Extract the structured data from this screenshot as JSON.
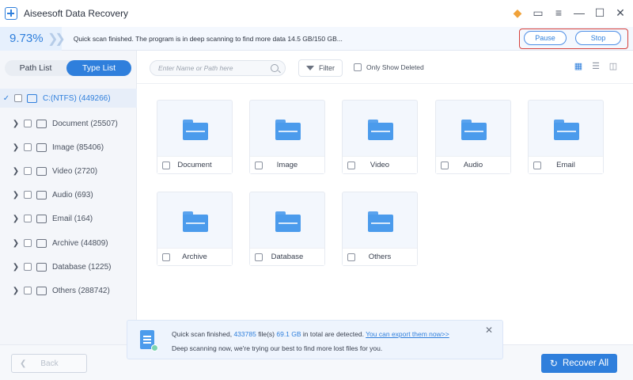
{
  "app": {
    "title": "Aiseesoft Data Recovery"
  },
  "titlebar_icons": [
    "diamond-icon",
    "feedback-icon",
    "menu-icon",
    "minimize-icon",
    "maximize-icon",
    "close-icon"
  ],
  "scan": {
    "percent": "9.73%",
    "progress_fraction": 0.0973,
    "message": "Quick scan finished. The program is in deep scanning to find more data 14.5 GB/150 GB...",
    "pause_label": "Pause",
    "stop_label": "Stop"
  },
  "sidebar": {
    "path_list_label": "Path List",
    "type_list_label": "Type List",
    "root": {
      "label": "C:(NTFS) (449266)"
    },
    "items": [
      {
        "label": "Document (25507)",
        "icon": "document-icon"
      },
      {
        "label": "Image (85406)",
        "icon": "image-icon"
      },
      {
        "label": "Video (2720)",
        "icon": "video-icon"
      },
      {
        "label": "Audio (693)",
        "icon": "audio-icon"
      },
      {
        "label": "Email (164)",
        "icon": "email-icon"
      },
      {
        "label": "Archive (44809)",
        "icon": "archive-icon"
      },
      {
        "label": "Database (1225)",
        "icon": "database-icon"
      },
      {
        "label": "Others (288742)",
        "icon": "folder-icon"
      }
    ]
  },
  "toolbar": {
    "search_placeholder": "Enter Name or Path here",
    "filter_label": "Filter",
    "only_deleted_label": "Only Show Deleted",
    "view_modes": [
      "grid-view-icon",
      "list-view-icon",
      "detail-view-icon"
    ]
  },
  "grid": {
    "cards": [
      {
        "label": "Document"
      },
      {
        "label": "Image"
      },
      {
        "label": "Video"
      },
      {
        "label": "Audio"
      },
      {
        "label": "Email"
      },
      {
        "label": "Archive"
      },
      {
        "label": "Database"
      },
      {
        "label": "Others"
      }
    ]
  },
  "toast": {
    "line1_prefix": "Quick scan finished,",
    "files_count": "433785",
    "line1_mid": "file(s)",
    "size": "69.1 GB",
    "line1_suffix": "in total are detected.",
    "export_link": "You can export them now>>",
    "line2": "Deep scanning now, we're trying our best to find more lost files for you."
  },
  "bottom": {
    "back_label": "Back",
    "recover_label": "Recover All"
  },
  "colors": {
    "accent": "#2f7fdc",
    "highlight_border": "#d6403b"
  }
}
